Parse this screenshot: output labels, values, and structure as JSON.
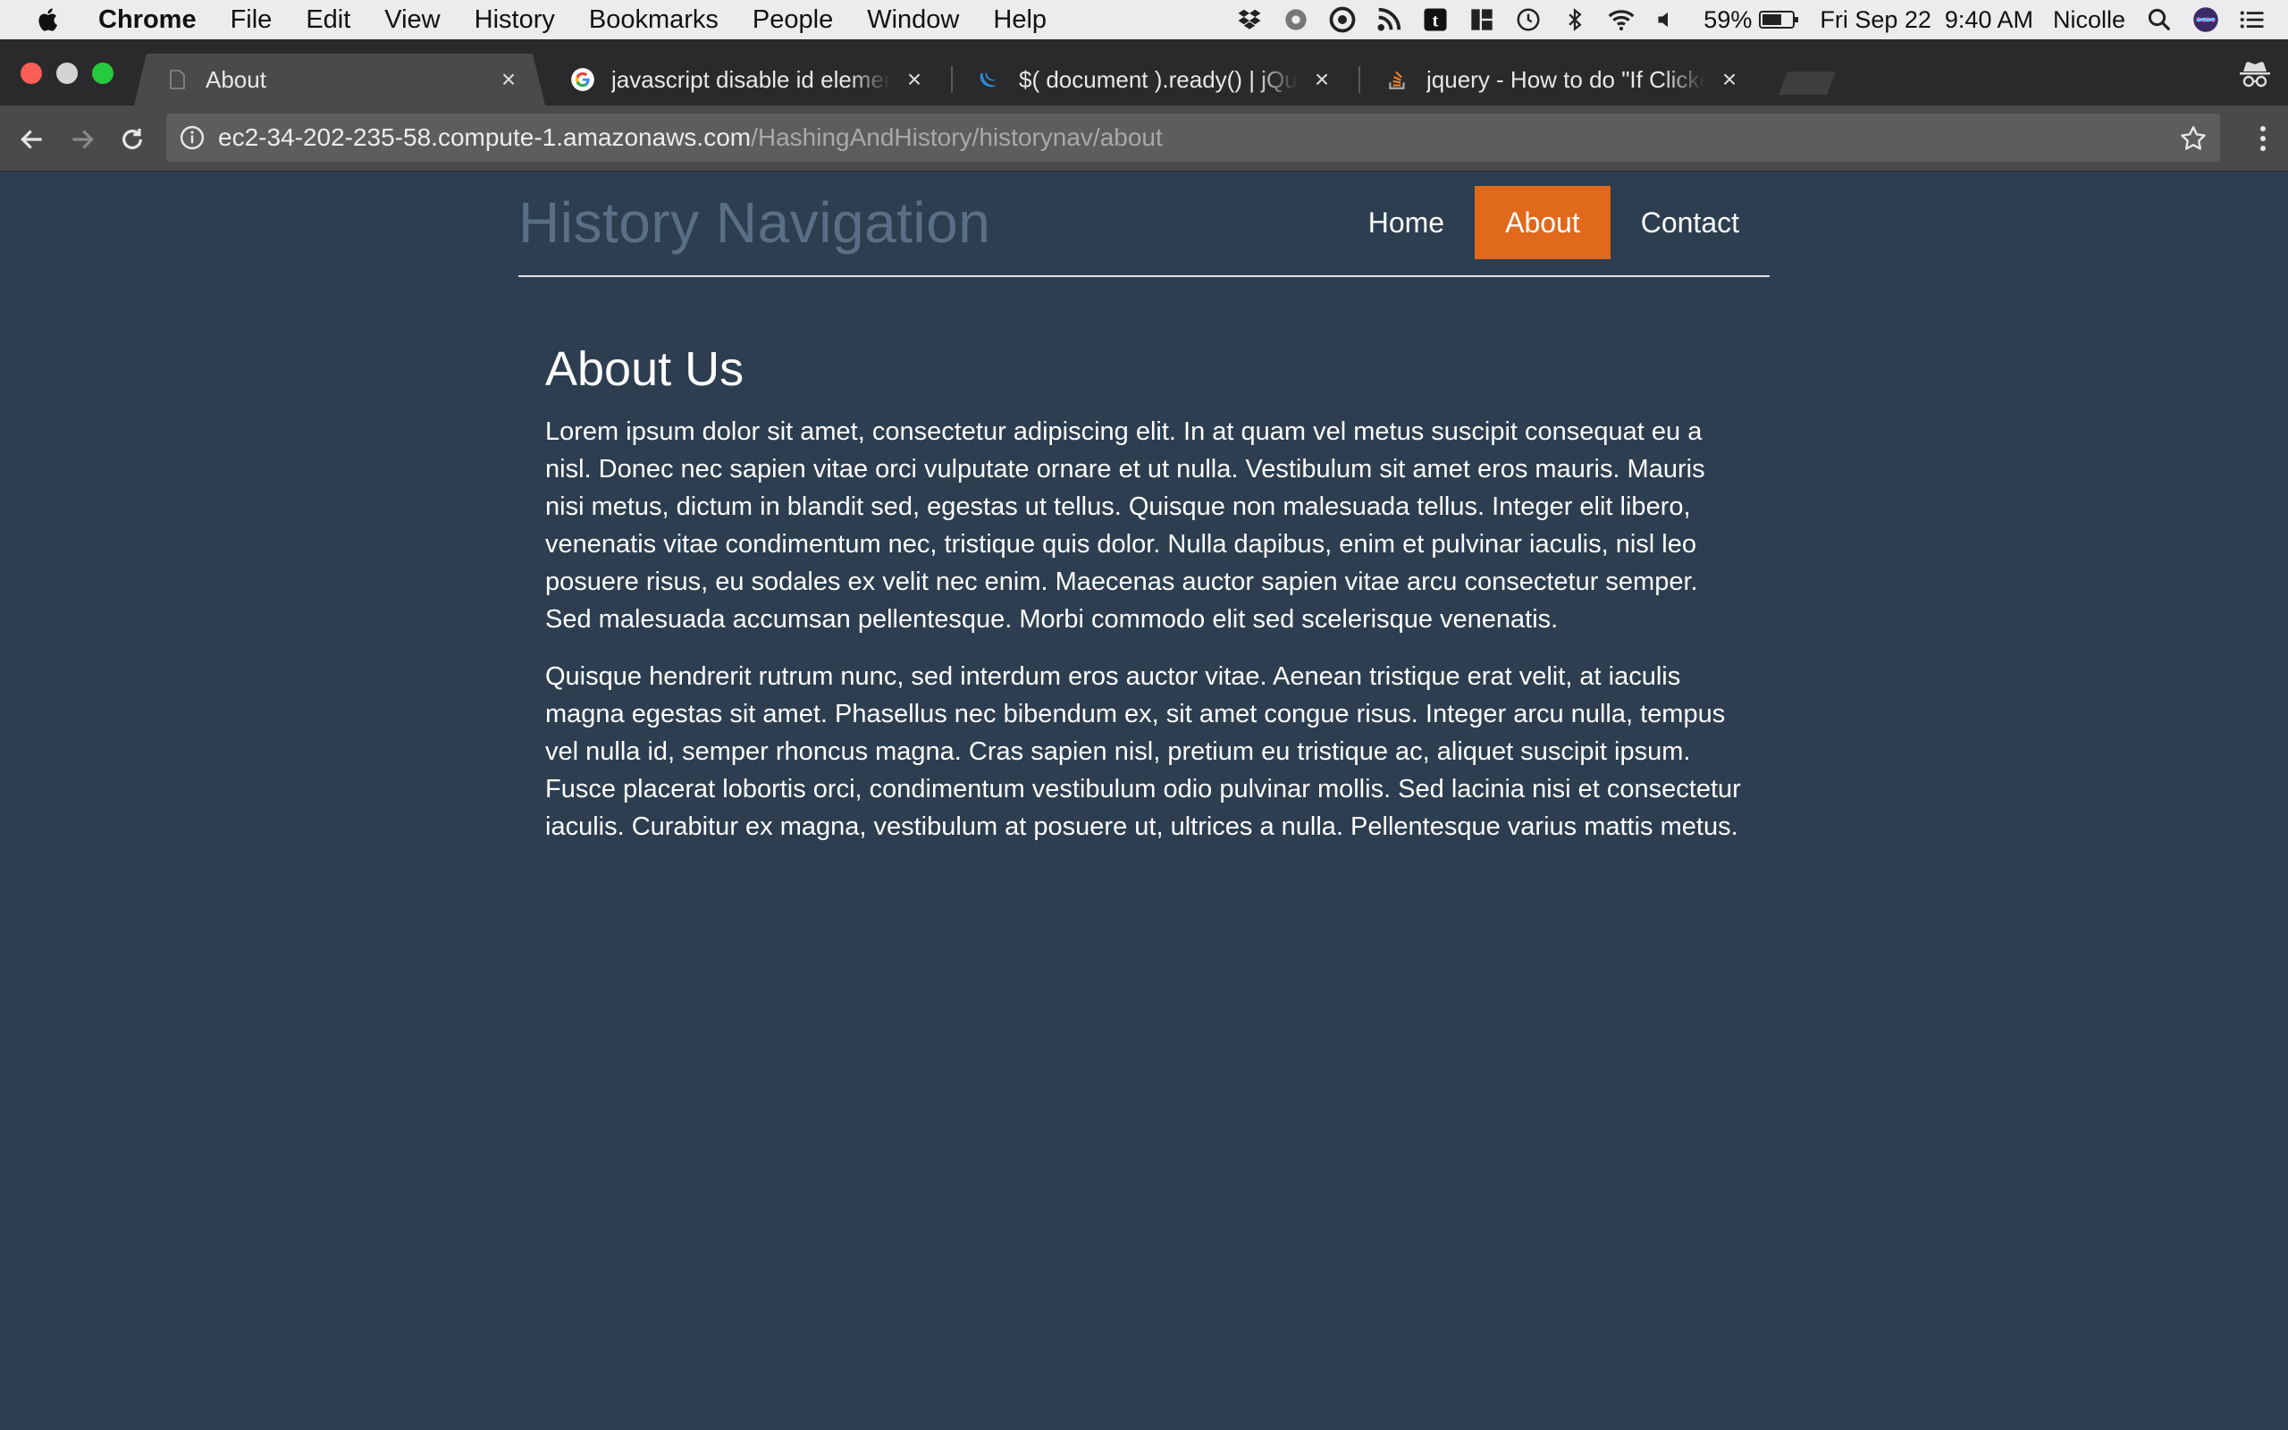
{
  "menubar": {
    "app": "Chrome",
    "items": [
      "File",
      "Edit",
      "View",
      "History",
      "Bookmarks",
      "People",
      "Window",
      "Help"
    ],
    "battery": "59%",
    "datetime": "Fri Sep 22  9:40 AM",
    "user": "Nicolle"
  },
  "tabs": [
    {
      "title": "About",
      "active": true,
      "icon": "blank-page-icon"
    },
    {
      "title": "javascript disable id element - Google Search",
      "active": false,
      "icon": "google-icon"
    },
    {
      "title": "$( document ).ready() | jQuery Learning Center",
      "active": false,
      "icon": "jquery-icon"
    },
    {
      "title": "jquery - How to do \"If Clicked Else ..\" - Stack Overflow",
      "active": false,
      "icon": "stackoverflow-icon"
    }
  ],
  "address": {
    "host": "ec2-34-202-235-58.compute-1.amazonaws.com",
    "path": "/HashingAndHistory/historynav/about"
  },
  "site": {
    "title": "History Navigation",
    "nav": [
      {
        "label": "Home",
        "active": false
      },
      {
        "label": "About",
        "active": true
      },
      {
        "label": "Contact",
        "active": false
      }
    ]
  },
  "content": {
    "heading": "About Us",
    "paragraphs": [
      "Lorem ipsum dolor sit amet, consectetur adipiscing elit. In at quam vel metus suscipit consequat eu a nisl. Donec nec sapien vitae orci vulputate ornare et ut nulla. Vestibulum sit amet eros mauris. Mauris nisi metus, dictum in blandit sed, egestas ut tellus. Quisque non malesuada tellus. Integer elit libero, venenatis vitae condimentum nec, tristique quis dolor. Nulla dapibus, enim et pulvinar iaculis, nisl leo posuere risus, eu sodales ex velit nec enim. Maecenas auctor sapien vitae arcu consectetur semper. Sed malesuada accumsan pellentesque. Morbi commodo elit sed scelerisque venenatis.",
      "Quisque hendrerit rutrum nunc, sed interdum eros auctor vitae. Aenean tristique erat velit, at iaculis magna egestas sit amet. Phasellus nec bibendum ex, sit amet congue risus. Integer arcu nulla, tempus vel nulla id, semper rhoncus magna. Cras sapien nisl, pretium eu tristique ac, aliquet suscipit ipsum. Fusce placerat lobortis orci, condimentum vestibulum odio pulvinar mollis. Sed lacinia nisi et consectetur iaculis. Curabitur ex magna, vestibulum at posuere ut, ultrices a nulla. Pellentesque varius mattis metus."
    ]
  },
  "colors": {
    "page_background": "#2c3e50",
    "nav_active": "#e0691c",
    "site_title": "#5b6f84"
  }
}
